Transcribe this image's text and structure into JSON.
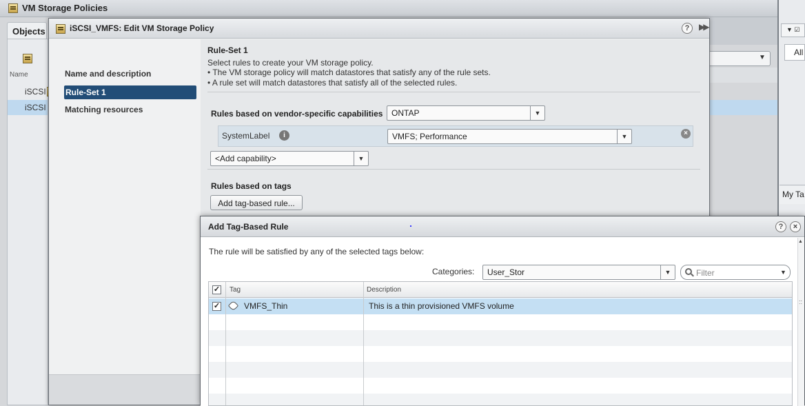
{
  "app": {
    "title": "VM Storage Policies"
  },
  "objects_tab": {
    "label": "Objects"
  },
  "left_list": {
    "column_header": "Name",
    "rows": [
      "iSCSI",
      "iSCSI"
    ]
  },
  "right_edge": {
    "tab_label": "All",
    "tag_label": "My Ta"
  },
  "edit_dialog": {
    "title": "iSCSI_VMFS: Edit VM Storage Policy",
    "help_icon": "question-icon",
    "nav": {
      "items": [
        "Name and description",
        "Rule-Set 1",
        "Matching resources"
      ],
      "selected": "Rule-Set 1"
    },
    "rule_set": {
      "title": "Rule-Set 1",
      "description": [
        "Select rules to create your VM storage policy.",
        "• The VM storage policy will match datastores that satisfy any of the rule sets.",
        "• A rule set will match datastores that satisfy all of the selected rules."
      ],
      "vendor_label": "Rules based on vendor-specific capabilities",
      "vendor_value": "ONTAP",
      "capability": {
        "label": "SystemLabel",
        "value": "VMFS; Performance"
      },
      "add_capability": "<Add capability>",
      "tags_label": "Rules based on tags",
      "add_tag_button": "Add tag-based rule..."
    }
  },
  "tag_dialog": {
    "title": "Add Tag-Based Rule",
    "intro": "The rule will be satisfied by any of the selected tags below:",
    "categories_label": "Categories:",
    "categories_value": "User_Stor",
    "filter_placeholder": "Filter",
    "columns": {
      "tag": "Tag",
      "description": "Description"
    },
    "rows": [
      {
        "tag": "VMFS_Thin",
        "description": "This is a thin provisioned VMFS volume",
        "checked": true
      }
    ],
    "colors": {
      "selected_row": "#c4dff3",
      "nav_selected": "#224d77"
    }
  }
}
